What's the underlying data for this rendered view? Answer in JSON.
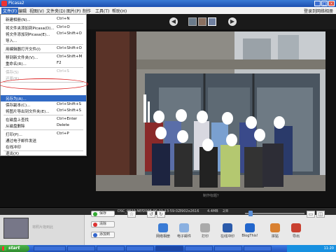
{
  "window": {
    "title": "Picasa2",
    "buttons": [
      "_",
      "□",
      "×"
    ],
    "colors": {
      "titlebar": "#1c4fb0",
      "highlight": "#316ac5",
      "menu_bg": "#ffffff",
      "photo_bg": "#111111"
    }
  },
  "menubar": {
    "items": [
      "文件(F)",
      "编辑",
      "视图(V)",
      "文件夹(D)",
      "图片(P)",
      "制作",
      "工具(T)",
      "帮助(H)"
    ],
    "right_link": "登录到网络相册"
  },
  "file_menu": {
    "items": [
      {
        "label": "新建相册(N)...",
        "shortcut": "Ctrl+N",
        "state": "normal"
      },
      {
        "label": "将文件夹添加到Picasa(D)...",
        "shortcut": "Ctrl+O",
        "state": "normal"
      },
      {
        "label": "将文件添加到Picasa(E)...",
        "shortcut": "Ctrl+Shift+O",
        "state": "normal"
      },
      {
        "label": "导入...",
        "shortcut": "",
        "state": "normal"
      },
      {
        "label": "用编辑器打开文件(I)",
        "shortcut": "Ctrl+Shift+O",
        "state": "normal"
      },
      {
        "label": "移到新文件夹(V)...",
        "shortcut": "Ctrl+Shift+M",
        "state": "normal"
      },
      {
        "label": "重命名(R)...",
        "shortcut": "F2",
        "state": "normal"
      },
      {
        "label": "保存(S)",
        "shortcut": "Ctrl+S",
        "state": "disabled"
      },
      {
        "label": "还原(R)",
        "shortcut": "",
        "state": "disabled"
      },
      {
        "label": "另存为(A)...",
        "shortcut": "",
        "state": "highlighted"
      },
      {
        "label": "保存副本(C)...",
        "shortcut": "Ctrl+Shift+S",
        "state": "normal"
      },
      {
        "label": "将图片导出到文件夹(E)...",
        "shortcut": "Ctrl+Shift+S",
        "state": "normal"
      },
      {
        "label": "在磁盘上查找",
        "shortcut": "Ctrl+Enter",
        "state": "normal"
      },
      {
        "label": "从磁盘删除",
        "shortcut": "Delete",
        "state": "normal"
      },
      {
        "label": "打印(P)...",
        "shortcut": "Ctrl+P",
        "state": "normal"
      },
      {
        "label": "通过电子邮件发送",
        "shortcut": "",
        "state": "normal"
      },
      {
        "label": "在线冲印",
        "shortcut": "",
        "state": "normal"
      },
      {
        "label": "退出(X)",
        "shortcut": "",
        "state": "normal"
      }
    ]
  },
  "photo": {
    "caption": "制作标题？",
    "description": "group photo of people in front of a glass building entrance"
  },
  "status": {
    "filename": "DSC_0622.NEF",
    "date": "2008-06-11 13:59:02",
    "dimensions": "3902x2616",
    "size": "4.4MB",
    "index": "2/8"
  },
  "tray": {
    "label": "将照片拖到此",
    "buttons": [
      "保存",
      "清除",
      "添加到"
    ]
  },
  "toolbar": {
    "buttons": [
      "网络相册",
      "电子邮件",
      "打印",
      "在线冲印",
      "BlogThis!",
      "拼贴",
      "导出"
    ]
  },
  "taskbar": {
    "start": "start",
    "clock": "11:20"
  }
}
